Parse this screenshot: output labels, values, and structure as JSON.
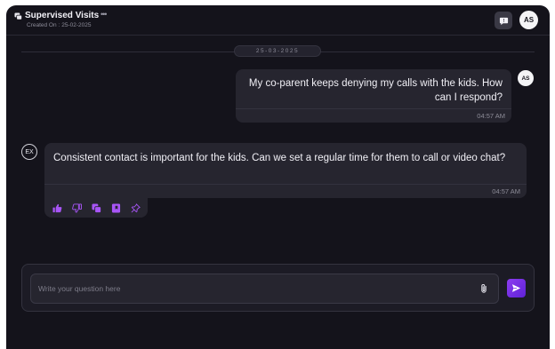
{
  "header": {
    "title": "Supervised Visits",
    "more_label": "•••",
    "created_label": "Created On :",
    "created_date": "25-02-2025",
    "user_initials": "AS"
  },
  "date_divider": "25-03-2025",
  "messages": [
    {
      "role": "user",
      "avatar": "AS",
      "text": "My co-parent keeps denying my calls with the kids. How can I respond?",
      "time": "04:57 AM"
    },
    {
      "role": "assistant",
      "avatar": "EX",
      "text": "Consistent contact is important for the kids. Can we set a regular time for them to call or video chat?",
      "time": "04:57 AM",
      "actions": [
        "thumbs-up-icon",
        "thumbs-down-icon",
        "copy-icon",
        "bookmark-icon",
        "pin-icon"
      ]
    }
  ],
  "composer": {
    "placeholder": "Write your question here",
    "value": ""
  },
  "colors": {
    "background": "#14131b",
    "bubble": "#26252f",
    "accent": "#a855f7",
    "send_button": "#7b2ff0"
  }
}
